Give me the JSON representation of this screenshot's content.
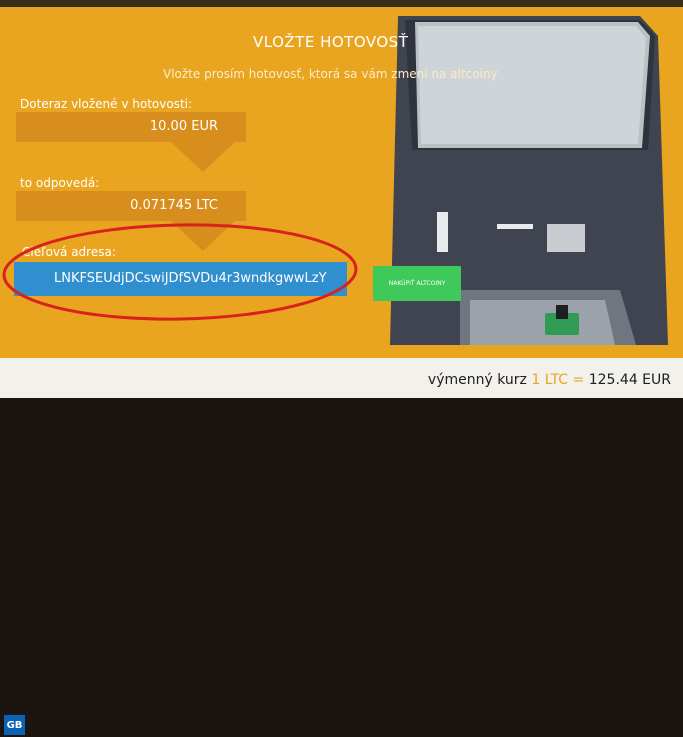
{
  "header": {
    "title": "VLOŽTE HOTOVOSŤ",
    "subtitle": "Vložte prosím hotovosť, ktorá sa vám zmení na altcoiny"
  },
  "deposit": {
    "inserted_label": "Doteraz vložené v hotovosti:",
    "inserted_value": "10.00 EUR",
    "equivalent_label": "to odpovedá:",
    "equivalent_value": "0.071745 LTC"
  },
  "target": {
    "label": "Cieľová adresa:",
    "address": "LNKFSEUdjDCswiJDfSVDu4r3wndkgwwLzY"
  },
  "buttons": {
    "buy": "NAKÚPIŤ ALTCOINY"
  },
  "footer": {
    "logo": "GB",
    "rate_label": "výmenný kurz",
    "rate_base": "1 LTC",
    "rate_eq": "=",
    "rate_value": "125.44 EUR"
  },
  "colors": {
    "background": "#e9a51f",
    "panel": "#d88e1c",
    "address": "#2f8fcf",
    "buy_button": "#3ec95a",
    "annotation": "#d9211e"
  },
  "icons": {
    "atm": "atm-machine-illustration",
    "logo": "gb-logo"
  }
}
